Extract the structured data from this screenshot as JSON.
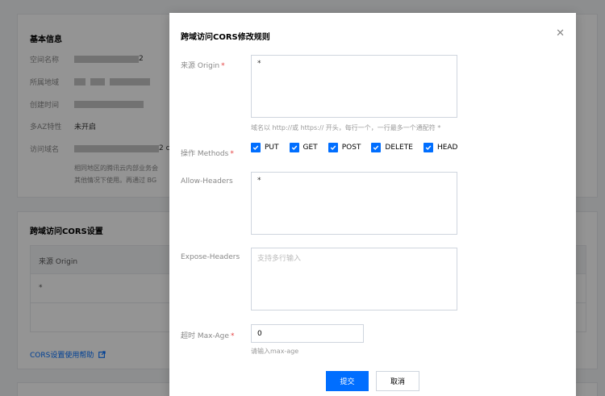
{
  "background": {
    "basic_info": {
      "title": "基本信息",
      "rows": [
        {
          "label": "空间名称",
          "value": "2"
        },
        {
          "label": "所属地域",
          "value": ""
        },
        {
          "label": "创建时间",
          "value": ""
        },
        {
          "label": "多AZ特性",
          "value": "未开启"
        },
        {
          "label": "访问域名",
          "value": "2 c"
        }
      ],
      "note_lines": [
        "相同地区的腾讯云内部业务会",
        "其他情况下使用。再通过 BG"
      ]
    },
    "cors": {
      "title": "跨域访问CORS设置",
      "table_header": "来源 Origin",
      "table_row": "*",
      "help_link": "CORS设置使用帮助"
    }
  },
  "modal": {
    "title": "跨域访问CORS修改规则",
    "close_icon": "close-icon",
    "origin": {
      "label": "来源 Origin",
      "required": "*",
      "value": "*",
      "hint": "域名以 http://或 https:// 开头，每行一个，一行最多一个通配符 *"
    },
    "methods": {
      "label": "操作 Methods",
      "required": "*",
      "options": [
        {
          "label": "PUT",
          "checked": true
        },
        {
          "label": "GET",
          "checked": true
        },
        {
          "label": "POST",
          "checked": true
        },
        {
          "label": "DELETE",
          "checked": true
        },
        {
          "label": "HEAD",
          "checked": true
        }
      ]
    },
    "allow_headers": {
      "label": "Allow-Headers",
      "value": "*"
    },
    "expose_headers": {
      "label": "Expose-Headers",
      "placeholder": "支持多行输入"
    },
    "max_age": {
      "label": "超时 Max-Age",
      "required": "*",
      "value": "0",
      "hint": "请输入max-age"
    },
    "submit_label": "提交",
    "cancel_label": "取消"
  },
  "colors": {
    "primary": "#006eff",
    "required": "#e54545"
  }
}
